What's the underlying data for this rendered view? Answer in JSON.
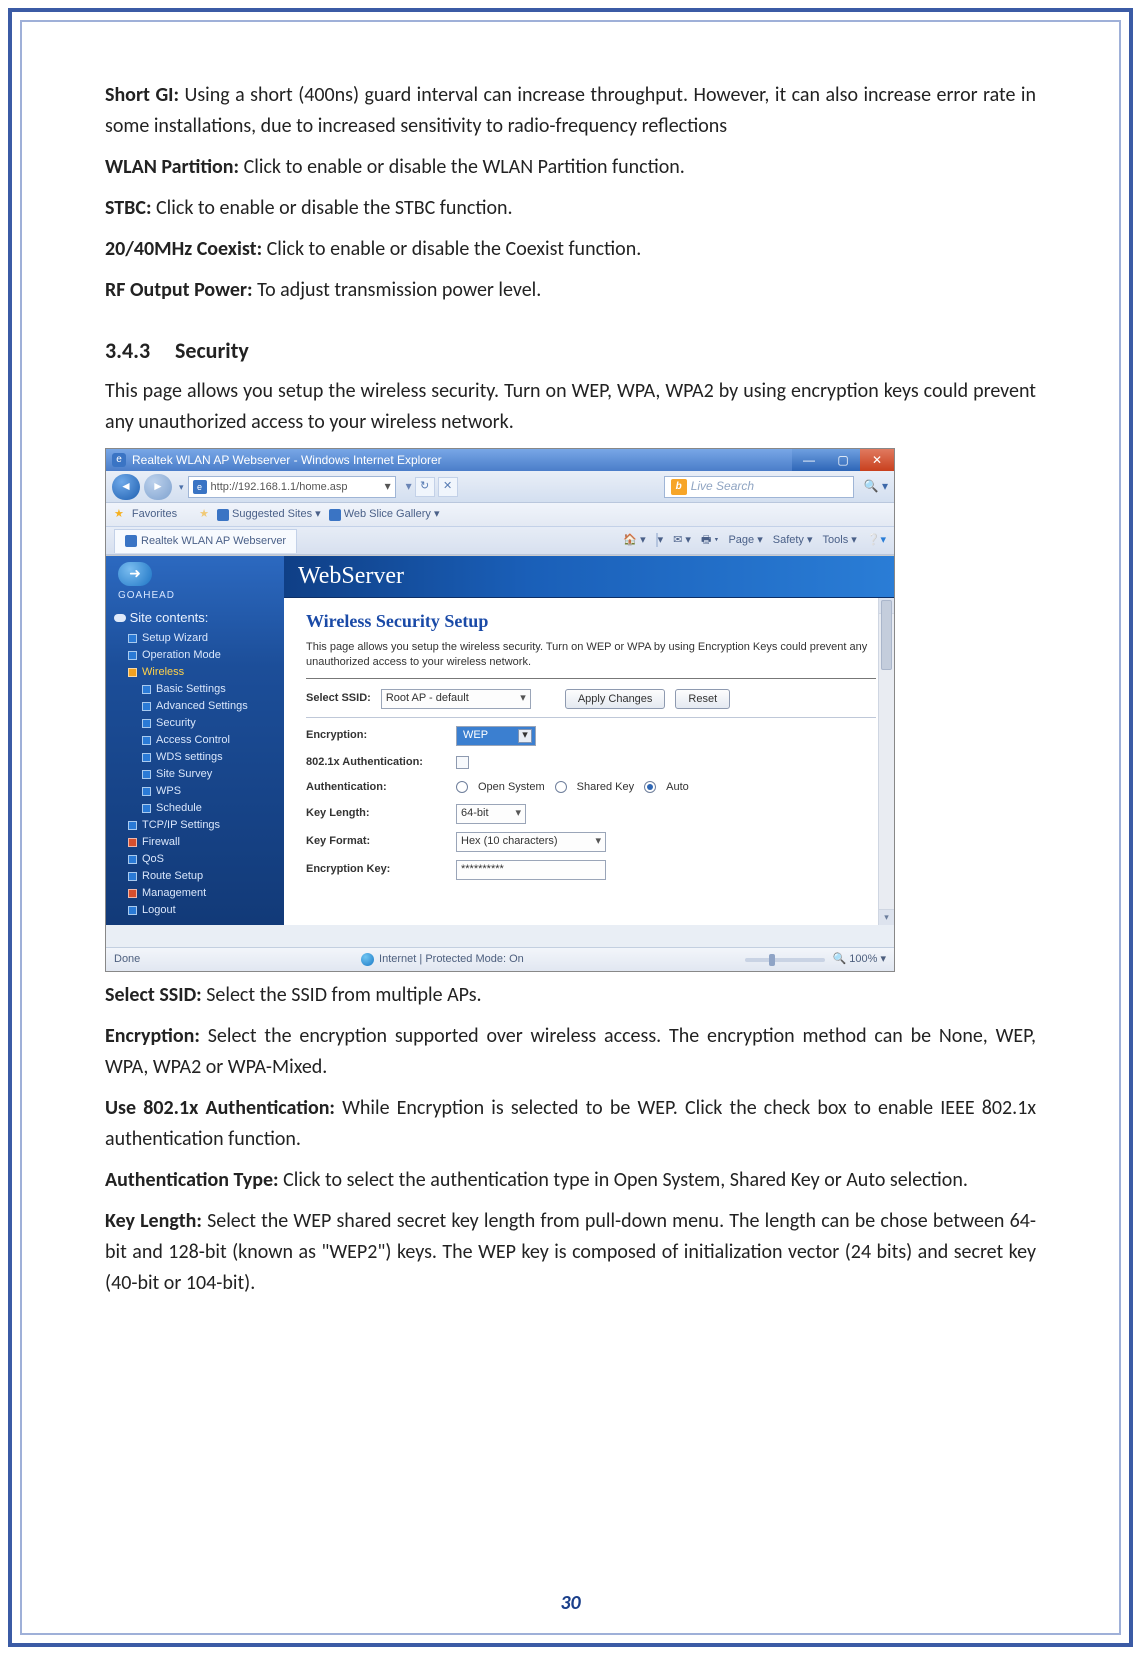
{
  "doc": {
    "short_gi": {
      "label": "Short GI:",
      "text": "Using a short (400ns) guard interval can increase throughput. However, it can also increase error rate in some installations, due to increased sensitivity to radio-frequency reflections"
    },
    "wlan_partition": {
      "label": "WLAN Partition:",
      "text": "Click to enable or disable the WLAN Partition function."
    },
    "stbc": {
      "label": "STBC:",
      "text": "Click to enable or disable the STBC function."
    },
    "coexist": {
      "label": "20/40MHz Coexist:",
      "text": "Click to enable or disable the Coexist function."
    },
    "rf_power": {
      "label": "RF Output Power:",
      "text": "To adjust transmission power level."
    },
    "section_num": "3.4.3",
    "section_title": "Security",
    "section_intro": "This page allows you setup the wireless security. Turn on WEP, WPA, WPA2 by using encryption keys could prevent any unauthorized access to your wireless network.",
    "select_ssid": {
      "label": "Select SSID:",
      "text": "Select the SSID from multiple APs."
    },
    "encryption": {
      "label": "Encryption:",
      "text": "Select the encryption supported over wireless access. The encryption method can be None, WEP, WPA, WPA2 or WPA-Mixed."
    },
    "use_8021x": {
      "label": "Use 802.1x Authentication:",
      "text": "While Encryption is selected to be WEP. Click the check box to enable IEEE 802.1x authentication function."
    },
    "auth_type": {
      "label": "Authentication Type:",
      "text": "Click to select the authentication type in Open System, Shared Key or Auto selection."
    },
    "key_length": {
      "label": "Key Length:",
      "text": "Select the WEP shared secret key length from pull-down menu. The length can be chose between 64-bit and 128-bit (known as \"WEP2\") keys.   The WEP key is composed of initialization vector (24 bits) and secret key (40-bit or 104-bit)."
    },
    "page_number": "30"
  },
  "ie": {
    "title": "Realtek WLAN AP Webserver - Windows Internet Explorer",
    "url": "http://192.168.1.1/home.asp",
    "search_placeholder": "Live Search",
    "favorites_label": "Favorites",
    "fav_links": [
      "Suggested Sites ▾",
      "Web Slice Gallery ▾"
    ],
    "tab_label": "Realtek WLAN AP Webserver",
    "toolbar": {
      "page": "Page ▾",
      "safety": "Safety ▾",
      "tools": "Tools ▾"
    },
    "status_left": "Done",
    "status_mid": "Internet | Protected Mode: On",
    "zoom": "100%"
  },
  "ws": {
    "brand_top": "GOAHEAD",
    "banner": "WebServer",
    "sidebar": {
      "title": "Site contents:",
      "items": [
        {
          "label": "Setup Wizard",
          "level": 1,
          "icon": "blue"
        },
        {
          "label": "Operation Mode",
          "level": 1,
          "icon": "blue"
        },
        {
          "label": "Wireless",
          "level": 1,
          "icon": "orange",
          "highlight": true
        },
        {
          "label": "Basic Settings",
          "level": 2,
          "icon": "blue"
        },
        {
          "label": "Advanced Settings",
          "level": 2,
          "icon": "blue"
        },
        {
          "label": "Security",
          "level": 2,
          "icon": "blue"
        },
        {
          "label": "Access Control",
          "level": 2,
          "icon": "blue"
        },
        {
          "label": "WDS settings",
          "level": 2,
          "icon": "blue"
        },
        {
          "label": "Site Survey",
          "level": 2,
          "icon": "blue"
        },
        {
          "label": "WPS",
          "level": 2,
          "icon": "blue"
        },
        {
          "label": "Schedule",
          "level": 2,
          "icon": "blue"
        },
        {
          "label": "TCP/IP Settings",
          "level": 1,
          "icon": "blue"
        },
        {
          "label": "Firewall",
          "level": 1,
          "icon": "red"
        },
        {
          "label": "QoS",
          "level": 1,
          "icon": "blue"
        },
        {
          "label": "Route Setup",
          "level": 1,
          "icon": "blue"
        },
        {
          "label": "Management",
          "level": 1,
          "icon": "red"
        },
        {
          "label": "Logout",
          "level": 1,
          "icon": "blue"
        }
      ]
    },
    "pane_title": "Wireless Security Setup",
    "pane_desc": "This page allows you setup the wireless security. Turn on WEP or WPA by using Encryption Keys could prevent any unauthorized access to your wireless network.",
    "ssid_label": "Select SSID:",
    "ssid_value": "Root AP - default",
    "apply_btn": "Apply Changes",
    "reset_btn": "Reset",
    "rows": {
      "encryption": {
        "label": "Encryption:",
        "value": "WEP"
      },
      "auth_8021x": {
        "label": "802.1x Authentication:"
      },
      "auth": {
        "label": "Authentication:",
        "options": [
          "Open System",
          "Shared Key",
          "Auto"
        ],
        "selected": "Auto"
      },
      "key_len": {
        "label": "Key Length:",
        "value": "64-bit"
      },
      "key_fmt": {
        "label": "Key Format:",
        "value": "Hex (10 characters)"
      },
      "enc_key": {
        "label": "Encryption Key:",
        "value": "**********"
      }
    }
  }
}
